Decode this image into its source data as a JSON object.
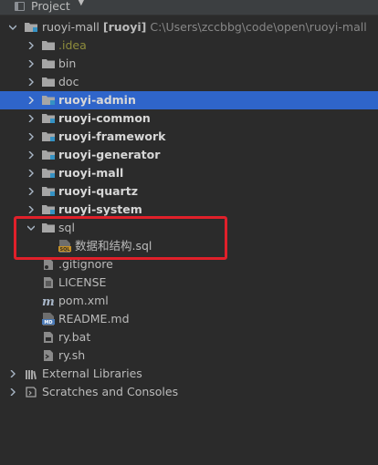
{
  "panel": {
    "title": "Project",
    "colors": {
      "background": "#2b2b2b",
      "selection": "#2f65ca",
      "highlight_box": "#e0202a"
    }
  },
  "root": {
    "name": "ruoyi-mall",
    "bracket": "[ruoyi]",
    "path": "C:\\Users\\zccbbg\\code\\open\\ruoyi-mall"
  },
  "items": {
    "idea": ".idea",
    "bin": "bin",
    "doc": "doc",
    "ruoyi_admin": "ruoyi-admin",
    "ruoyi_common": "ruoyi-common",
    "ruoyi_framework": "ruoyi-framework",
    "ruoyi_generator": "ruoyi-generator",
    "ruoyi_mall": "ruoyi-mall",
    "ruoyi_quartz": "ruoyi-quartz",
    "ruoyi_system": "ruoyi-system",
    "sql": "sql",
    "sql_file": "数据和结构.sql",
    "gitignore": ".gitignore",
    "license": "LICENSE",
    "pom": "pom.xml",
    "readme": "README.md",
    "ry_bat": "ry.bat",
    "ry_sh": "ry.sh",
    "external_libraries": "External Libraries",
    "scratches": "Scratches and Consoles"
  },
  "icons": {
    "sql_file_badge": "SQL",
    "readme_badge": "MD"
  }
}
